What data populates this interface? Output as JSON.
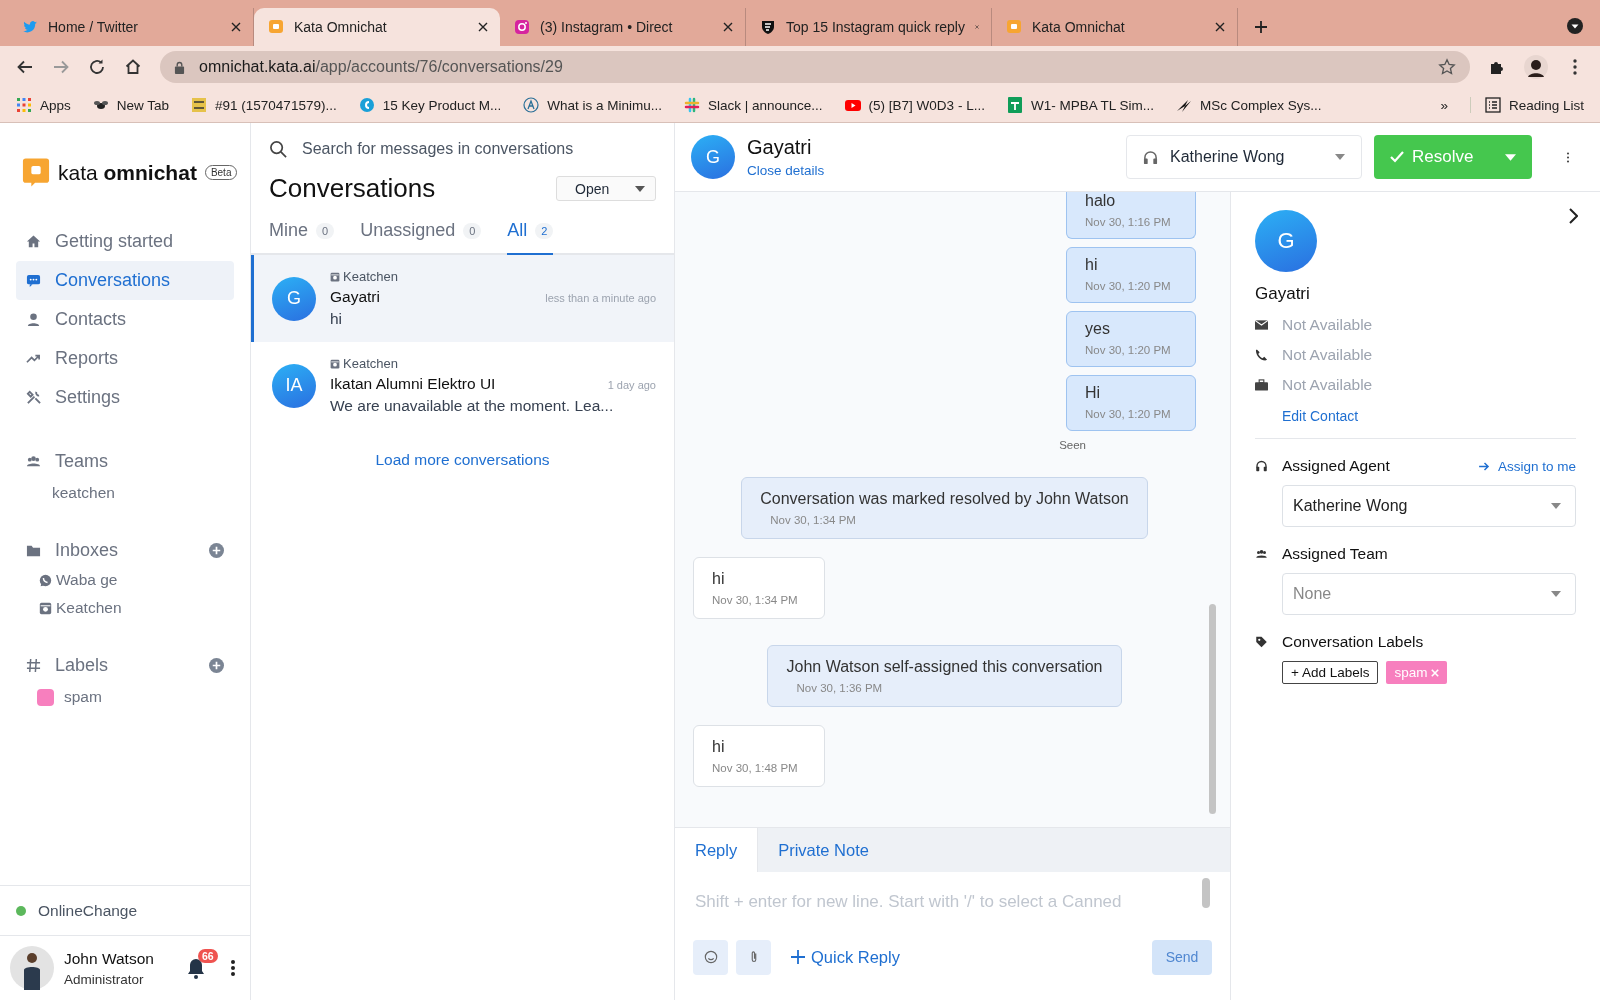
{
  "browser": {
    "tabs": [
      {
        "title": "Home / Twitter",
        "kind": "twitter",
        "selected": false
      },
      {
        "title": "Kata Omnichat",
        "kind": "kata",
        "selected": true
      },
      {
        "title": "(3) Instagram • Direct",
        "kind": "instagram",
        "selected": false
      },
      {
        "title": "Top 15 Instagram quick reply",
        "kind": "shield",
        "selected": false
      },
      {
        "title": "Kata Omnichat",
        "kind": "kata",
        "selected": false
      }
    ],
    "url_host": "omnichat.kata.ai",
    "url_path": "/app/accounts/76/conversations/29",
    "bookmarks": [
      {
        "label": "Apps",
        "kind": "grid"
      },
      {
        "label": "New Tab",
        "kind": "bee"
      },
      {
        "label": "#91 (1570471579)...",
        "kind": "tile"
      },
      {
        "label": "15 Key Product M...",
        "kind": "drop"
      },
      {
        "label": "What is a Minimu...",
        "kind": "letter"
      },
      {
        "label": "Slack | announce...",
        "kind": "slack"
      },
      {
        "label": "(5) [B7] W0D3 - L...",
        "kind": "youtube"
      },
      {
        "label": "W1- MPBA TL Sim...",
        "kind": "sheets"
      },
      {
        "label": "MSc Complex Sys...",
        "kind": "swoosh"
      }
    ],
    "overflow": "»",
    "reading_list": "Reading List"
  },
  "sidebar": {
    "brand": "kata",
    "brand_bold": "omnichat",
    "badge": "Beta",
    "nav": [
      {
        "label": "Getting started",
        "kind": "home",
        "selected": false
      },
      {
        "label": "Conversations",
        "kind": "chat",
        "selected": true
      },
      {
        "label": "Contacts",
        "kind": "person",
        "selected": false
      },
      {
        "label": "Reports",
        "kind": "trend",
        "selected": false
      },
      {
        "label": "Settings",
        "kind": "tools",
        "selected": false
      }
    ],
    "teams": {
      "title": "Teams",
      "items": [
        "keatchen"
      ]
    },
    "inboxes": {
      "title": "Inboxes",
      "items": [
        {
          "label": "Waba ge",
          "kind": "whatsapp"
        },
        {
          "label": "Keatchen",
          "kind": "camera"
        }
      ]
    },
    "labels": {
      "title": "Labels",
      "items": [
        {
          "label": "spam",
          "color": "#f77fbe"
        }
      ]
    },
    "status": {
      "label": "Online",
      "action": "Change",
      "online": true
    },
    "user": {
      "name": "John Watson",
      "role": "Administrator",
      "notifications": "66"
    }
  },
  "conversations": {
    "search_placeholder": "Search for messages in conversations",
    "title": "Conversations",
    "filter": "Open",
    "tabs": [
      {
        "label": "Mine",
        "count": "0",
        "selected": false
      },
      {
        "label": "Unassigned",
        "count": "0",
        "selected": false
      },
      {
        "label": "All",
        "count": "2",
        "selected": true
      }
    ],
    "items": [
      {
        "inbox": "Keatchen",
        "name": "Gayatri",
        "initials": "G",
        "time": "less than a minute ago",
        "preview": "hi",
        "selected": true
      },
      {
        "inbox": "Keatchen",
        "name": "Ikatan Alumni Elektro UI",
        "initials": "IA",
        "time": "1 day ago",
        "preview": "We are unavailable at the moment. Lea...",
        "selected": false
      }
    ],
    "load_more": "Load more conversations"
  },
  "chat": {
    "contact": "Gayatri",
    "initials": "G",
    "close_details": "Close details",
    "agent": "Katherine Wong",
    "resolve": "Resolve",
    "messages": [
      {
        "kind": "outgoing",
        "text": "halo",
        "time": "Nov 30, 1:16 PM"
      },
      {
        "kind": "outgoing",
        "text": "hi",
        "time": "Nov 30, 1:20 PM"
      },
      {
        "kind": "outgoing",
        "text": "yes",
        "time": "Nov 30, 1:20 PM"
      },
      {
        "kind": "outgoing",
        "text": "Hi",
        "time": "Nov 30, 1:20 PM",
        "status": "Seen"
      },
      {
        "kind": "activity",
        "text": "Conversation was marked resolved by John Watson",
        "time": "Nov 30, 1:34 PM"
      },
      {
        "kind": "incoming",
        "text": "hi",
        "time": "Nov 30, 1:34 PM"
      },
      {
        "kind": "activity",
        "text": "John Watson self-assigned this conversation",
        "time": "Nov 30, 1:36 PM"
      },
      {
        "kind": "incoming",
        "text": "hi",
        "time": "Nov 30, 1:48 PM"
      }
    ],
    "reply_tabs": [
      {
        "label": "Reply",
        "selected": true
      },
      {
        "label": "Private Note",
        "selected": false
      }
    ],
    "placeholder": "Shift + enter for new line. Start with '/' to select a Canned",
    "quick_reply": "Quick Reply",
    "send": "Send",
    "send_disabled": true
  },
  "details": {
    "initials": "G",
    "name": "Gayatri",
    "fields": [
      {
        "kind": "email",
        "value": "Not Available"
      },
      {
        "kind": "phone",
        "value": "Not Available"
      },
      {
        "kind": "company",
        "value": "Not Available"
      }
    ],
    "edit": "Edit Contact",
    "agent_title": "Assigned Agent",
    "assign_me": "Assign to me",
    "agent": "Katherine Wong",
    "team_title": "Assigned Team",
    "team": "None",
    "labels_title": "Conversation Labels",
    "add_labels": "+ Add Labels",
    "labels": [
      {
        "label": "spam",
        "color": "#f77fbe"
      }
    ]
  }
}
